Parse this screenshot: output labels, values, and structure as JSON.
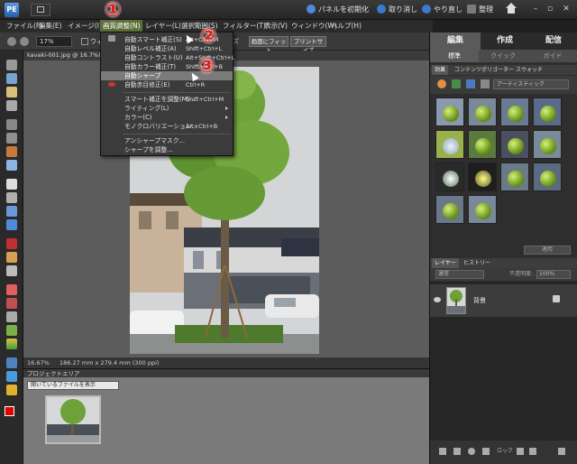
{
  "titlebar": {
    "logo": "PE",
    "reset_panels": "パネルを初期化",
    "undo": "取り消し",
    "redo": "やり直し",
    "organize": "整理"
  },
  "menubar": {
    "items": [
      "ファイル(F)",
      "編集(E)",
      "イメージ(I)",
      "画質調整(N)",
      "レイヤー(L)",
      "選択範囲(S)",
      "フィルター(T)",
      "表示(V)",
      "ウィンドウ(W)",
      "ヘルプ(H)"
    ],
    "active_index": 3
  },
  "optbar": {
    "zoom_value": "17%",
    "window_fit_label": "ウィ",
    "screen_fit": "画面にフィット",
    "print_size": "プリントサイズ",
    "resize_label": "ズ"
  },
  "document": {
    "tab_title": "kavaki-001.jpg @ 16.7%(RGB/8)",
    "zoom_status": "16.67%",
    "size_status": "186.27 mm x 279.4 mm (300 ppi)"
  },
  "dropdown": {
    "items": [
      {
        "label": "自動スマート補正(S)",
        "shortcut": "Alt+Ctrl+M"
      },
      {
        "label": "自動レベル補正(A)",
        "shortcut": "Shift+Ctrl+L"
      },
      {
        "label": "自動コントラスト(U)",
        "shortcut": "Alt+Shift+Ctrl+L"
      },
      {
        "label": "自動カラー補正(T)",
        "shortcut": "Shift+Ctrl+B"
      },
      {
        "label": "自動シャープ",
        "shortcut": ""
      },
      {
        "label": "自動赤目修正(E)",
        "shortcut": "Ctrl+R"
      },
      {
        "label": "スマート補正を調整(M)...",
        "shortcut": "Shift+Ctrl+M"
      },
      {
        "label": "ライティング(L)",
        "shortcut": ""
      },
      {
        "label": "カラー(C)",
        "shortcut": ""
      },
      {
        "label": "モノクロバリエーション...",
        "shortcut": "Alt+Ctrl+B"
      },
      {
        "label": "アンシャープマスク...",
        "shortcut": ""
      },
      {
        "label": "シャープを調整...",
        "shortcut": ""
      }
    ],
    "highlighted_index": 4
  },
  "callouts": [
    "①",
    "②",
    "③"
  ],
  "project": {
    "title": "プロジェクトエリア",
    "select_value": "開いているファイルを表示"
  },
  "panel": {
    "mode_tabs": [
      "編集",
      "作成",
      "配信"
    ],
    "sub_tabs": [
      "標準",
      "クイック",
      "ガイド"
    ],
    "fx_tabs": [
      "効果",
      "コンテンツ",
      "ポリゴーター",
      "スウォッチ"
    ],
    "fx_select": "アーティスティック",
    "apply": "適用",
    "layer_tabs": [
      "レイヤー",
      "ヒストリー"
    ],
    "blend_mode": "通常",
    "opacity_label": "不透明度:",
    "opacity_value": "100%",
    "layer_name": "背景",
    "lock_label": "ロック"
  },
  "colors": {
    "accent_active_menu": "#5d6f3a",
    "callout_red": "#e41b1b",
    "foreground_swatch": "#e00000",
    "background_swatch": "#ffffff"
  }
}
